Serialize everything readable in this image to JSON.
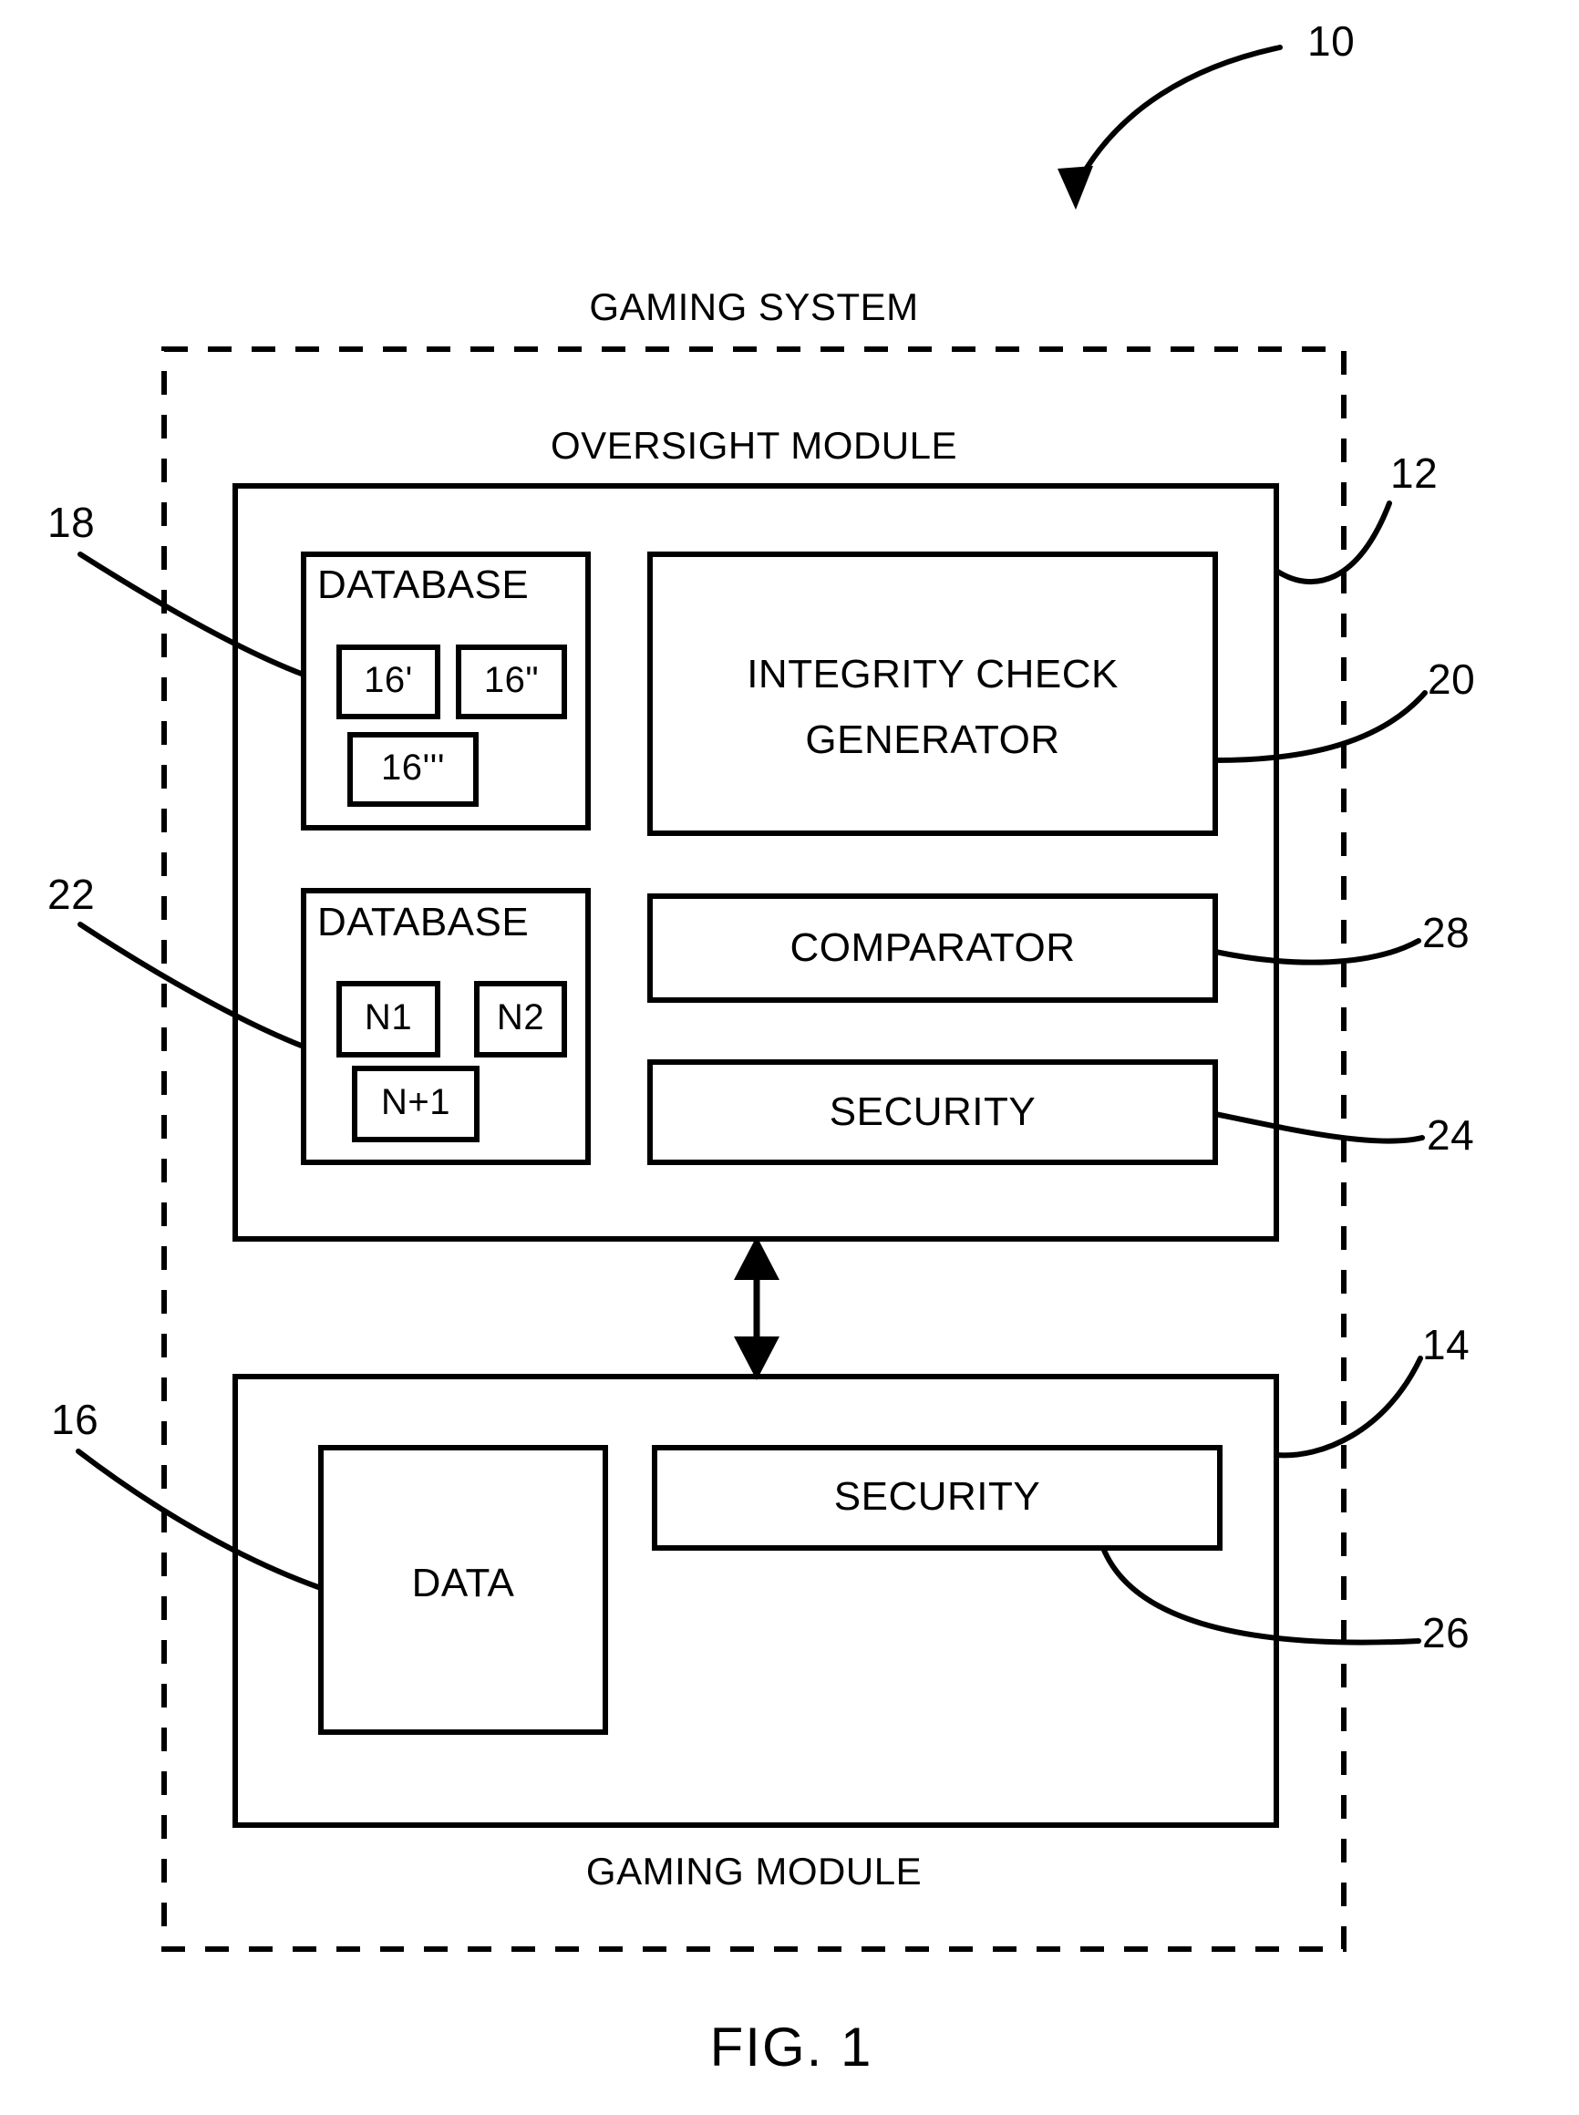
{
  "figure": {
    "caption": "FIG. 1",
    "system_label": "GAMING SYSTEM",
    "oversight_label": "OVERSIGHT MODULE",
    "gaming_module_label": "GAMING MODULE"
  },
  "reference_numerals": {
    "system": "10",
    "oversight_module": "12",
    "gaming_module": "14",
    "data": "16",
    "database_upper": "18",
    "integrity_check_generator": "20",
    "database_lower": "22",
    "oversight_security": "24",
    "gaming_security": "26",
    "comparator": "28"
  },
  "oversight_module": {
    "database_upper": {
      "title": "DATABASE",
      "items": [
        "16'",
        "16\"",
        "16'''"
      ]
    },
    "database_lower": {
      "title": "DATABASE",
      "items": [
        "N1",
        "N2",
        "N+1"
      ]
    },
    "integrity_check_generator": {
      "line1": "INTEGRITY CHECK",
      "line2": "GENERATOR"
    },
    "comparator": {
      "title": "COMPARATOR"
    },
    "security": {
      "title": "SECURITY"
    }
  },
  "gaming_module": {
    "data": {
      "title": "DATA"
    },
    "security": {
      "title": "SECURITY"
    }
  },
  "style": {
    "ink": "#000000",
    "paper": "#ffffff"
  }
}
